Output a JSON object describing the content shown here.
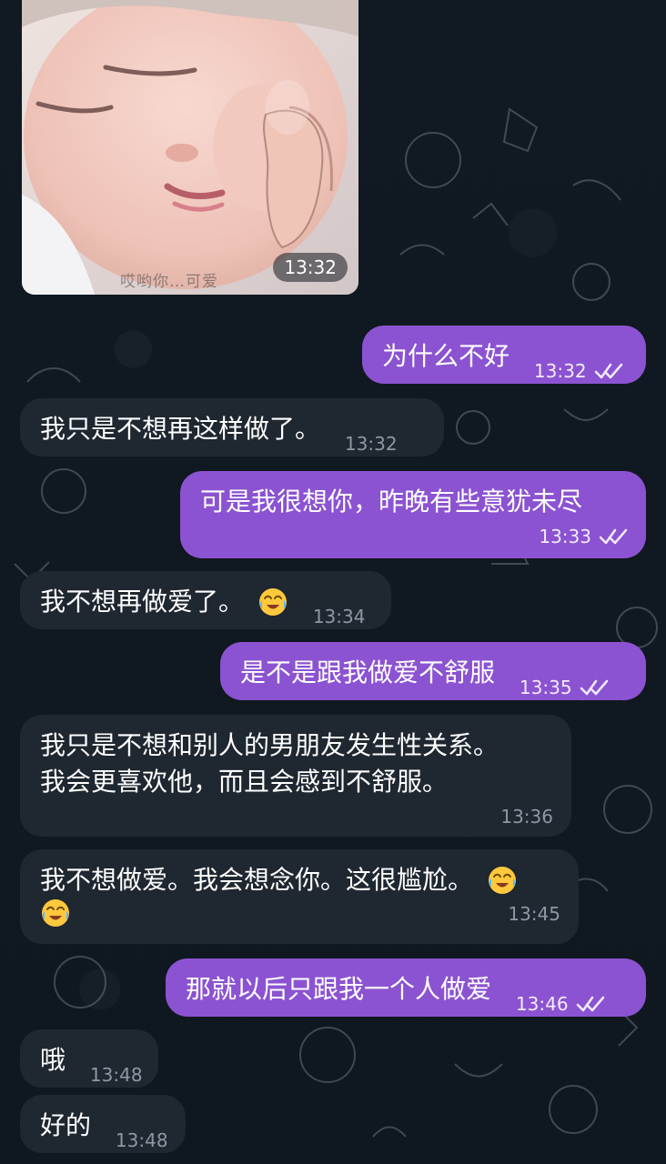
{
  "photo": {
    "time": "13:32",
    "watermark": "哎哟你…可爱"
  },
  "messages": [
    {
      "side": "out",
      "text": "为什么不好",
      "time": "13:32"
    },
    {
      "side": "in",
      "text": "我只是不想再这样做了。",
      "time": "13:32"
    },
    {
      "side": "out",
      "text": "可是我很想你，昨晚有些意犹未尽",
      "time": "13:33"
    },
    {
      "side": "in",
      "text": "我不想再做爱了。",
      "time": "13:34"
    },
    {
      "side": "out",
      "text": "是不是跟我做爱不舒服",
      "time": "13:35"
    },
    {
      "side": "in",
      "line1": "我只是不想和别人的男朋友发生性关系。",
      "line2": "我会更喜欢他，而且会感到不舒服。",
      "time": "13:36"
    },
    {
      "side": "in",
      "text": "我不想做爱。我会想念你。这很尴尬。",
      "time": "13:45"
    },
    {
      "side": "out",
      "text": "那就以后只跟我一个人做爱",
      "time": "13:46"
    },
    {
      "side": "in",
      "text": "哦",
      "time": "13:48"
    },
    {
      "side": "in",
      "text": "好的",
      "time": "13:48"
    }
  ],
  "icons": {
    "read_receipt": "double-check-icon",
    "emoji": "face-with-tears-of-joy-icon"
  },
  "colors": {
    "background": "#101820",
    "incoming_bubble": "#1f2730",
    "outgoing_bubble": "#8b53d1"
  }
}
